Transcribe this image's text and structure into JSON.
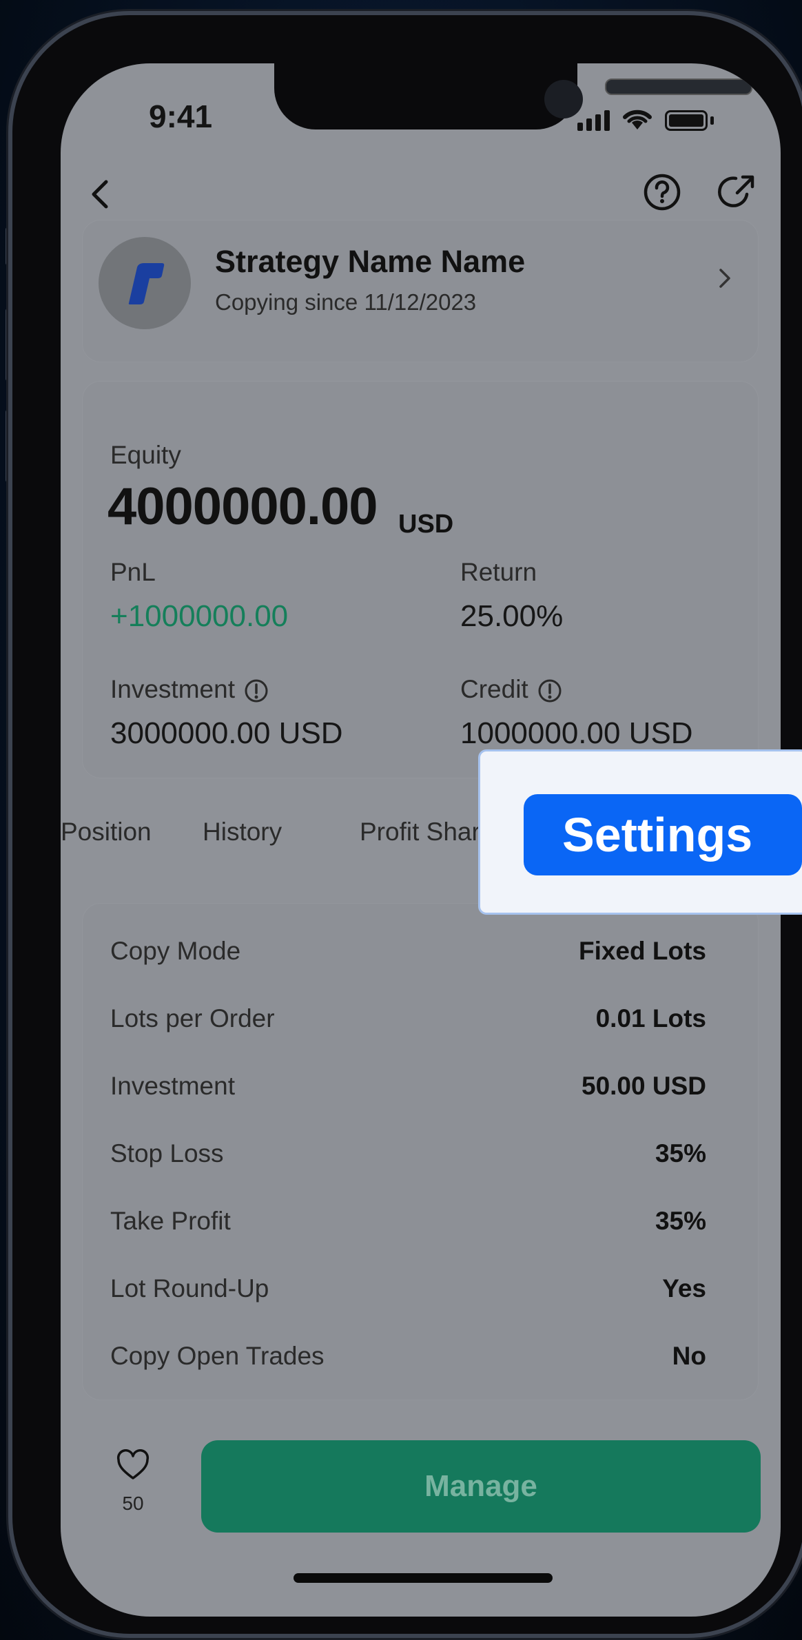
{
  "status_bar": {
    "time": "9:41"
  },
  "strategy": {
    "name": "Strategy Name Name",
    "since": "Copying since 11/12/2023"
  },
  "equity": {
    "label": "Equity",
    "value": "4000000.00",
    "unit": "USD"
  },
  "stats": {
    "pnl_label": "PnL",
    "pnl_value": "+1000000.00",
    "return_label": "Return",
    "return_value": "25.00%",
    "investment_label": "Investment",
    "investment_value": "3000000.00 USD",
    "credit_label": "Credit",
    "credit_value": "1000000.00 USD"
  },
  "tabs": [
    {
      "label": "Position"
    },
    {
      "label": "History"
    },
    {
      "label": "Profit Shari"
    }
  ],
  "settings_rows": [
    {
      "label": "Copy Mode",
      "value": "Fixed Lots"
    },
    {
      "label": "Lots per Order",
      "value": "0.01 Lots"
    },
    {
      "label": "Investment",
      "value": "50.00 USD"
    },
    {
      "label": "Stop Loss",
      "value": "35%"
    },
    {
      "label": "Take Profit",
      "value": "35%"
    },
    {
      "label": "Lot Round-Up",
      "value": "Yes"
    },
    {
      "label": "Copy Open Trades",
      "value": "No"
    }
  ],
  "footer": {
    "like_count": "50",
    "manage_label": "Manage"
  },
  "highlight": {
    "label": "Settings"
  },
  "colors": {
    "positive": "#157f5a",
    "manage_button": "#15795c",
    "highlight_button": "#0a66f5"
  },
  "icons": {
    "back": "chevron-left-icon",
    "help": "question-circle-icon",
    "share": "share-arrow-icon",
    "info": "info-circle-icon",
    "chevron": "chevron-right-icon",
    "like": "heart-icon"
  }
}
